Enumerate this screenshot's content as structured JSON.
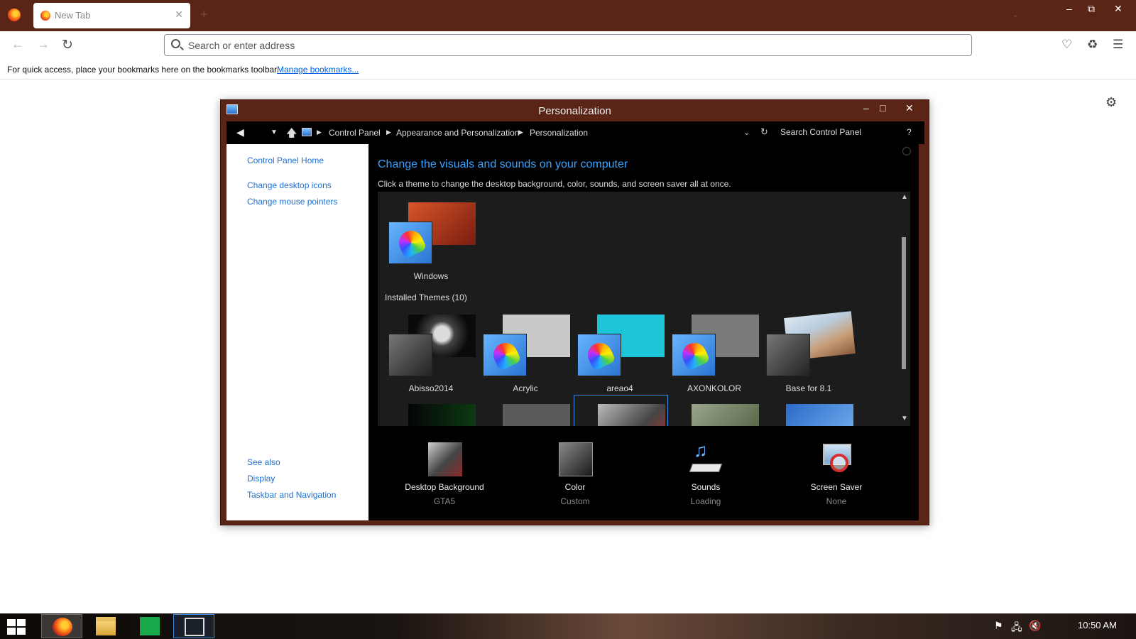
{
  "browser": {
    "tab_title": "New Tab",
    "tab_close": "✕",
    "new_tab": "+",
    "address_placeholder": "Search or enter address",
    "bookmarks_text": "For quick access, place your bookmarks here on the bookmarks toolbar.",
    "bookmarks_link": "Manage bookmarks...",
    "colors": {
      "titlebar": "#5a2416",
      "link": "#0060df"
    }
  },
  "window": {
    "title": "Personalization",
    "breadcrumb": [
      "Control Panel",
      "Appearance and Personalization",
      "Personalization"
    ],
    "search_placeholder": "Search Control Panel",
    "help": "?"
  },
  "sidebar": {
    "home": "Control Panel Home",
    "links": [
      "Change desktop icons",
      "Change mouse pointers"
    ],
    "see_also": "See also",
    "see_also_links": [
      "Display",
      "Taskbar and Navigation"
    ]
  },
  "main": {
    "heading": "Change the visuals and sounds on your computer",
    "subheading": "Click a theme to change the desktop background, color, sounds, and screen saver all at once.",
    "default_theme": "Windows",
    "installed_header": "Installed Themes (10)",
    "themes": [
      "Abisso2014",
      "Acrylic",
      "areao4",
      "AXONKOLOR",
      "Base for 8.1"
    ]
  },
  "bottom": [
    {
      "title": "Desktop Background",
      "value": "GTA5"
    },
    {
      "title": "Color",
      "value": "Custom"
    },
    {
      "title": "Sounds",
      "value": "Loading"
    },
    {
      "title": "Screen Saver",
      "value": "None"
    }
  ],
  "taskbar": {
    "time": "10:50 AM",
    "apps": [
      "firefox-icon",
      "file-explorer-icon",
      "store-icon",
      "control-panel-icon"
    ]
  }
}
